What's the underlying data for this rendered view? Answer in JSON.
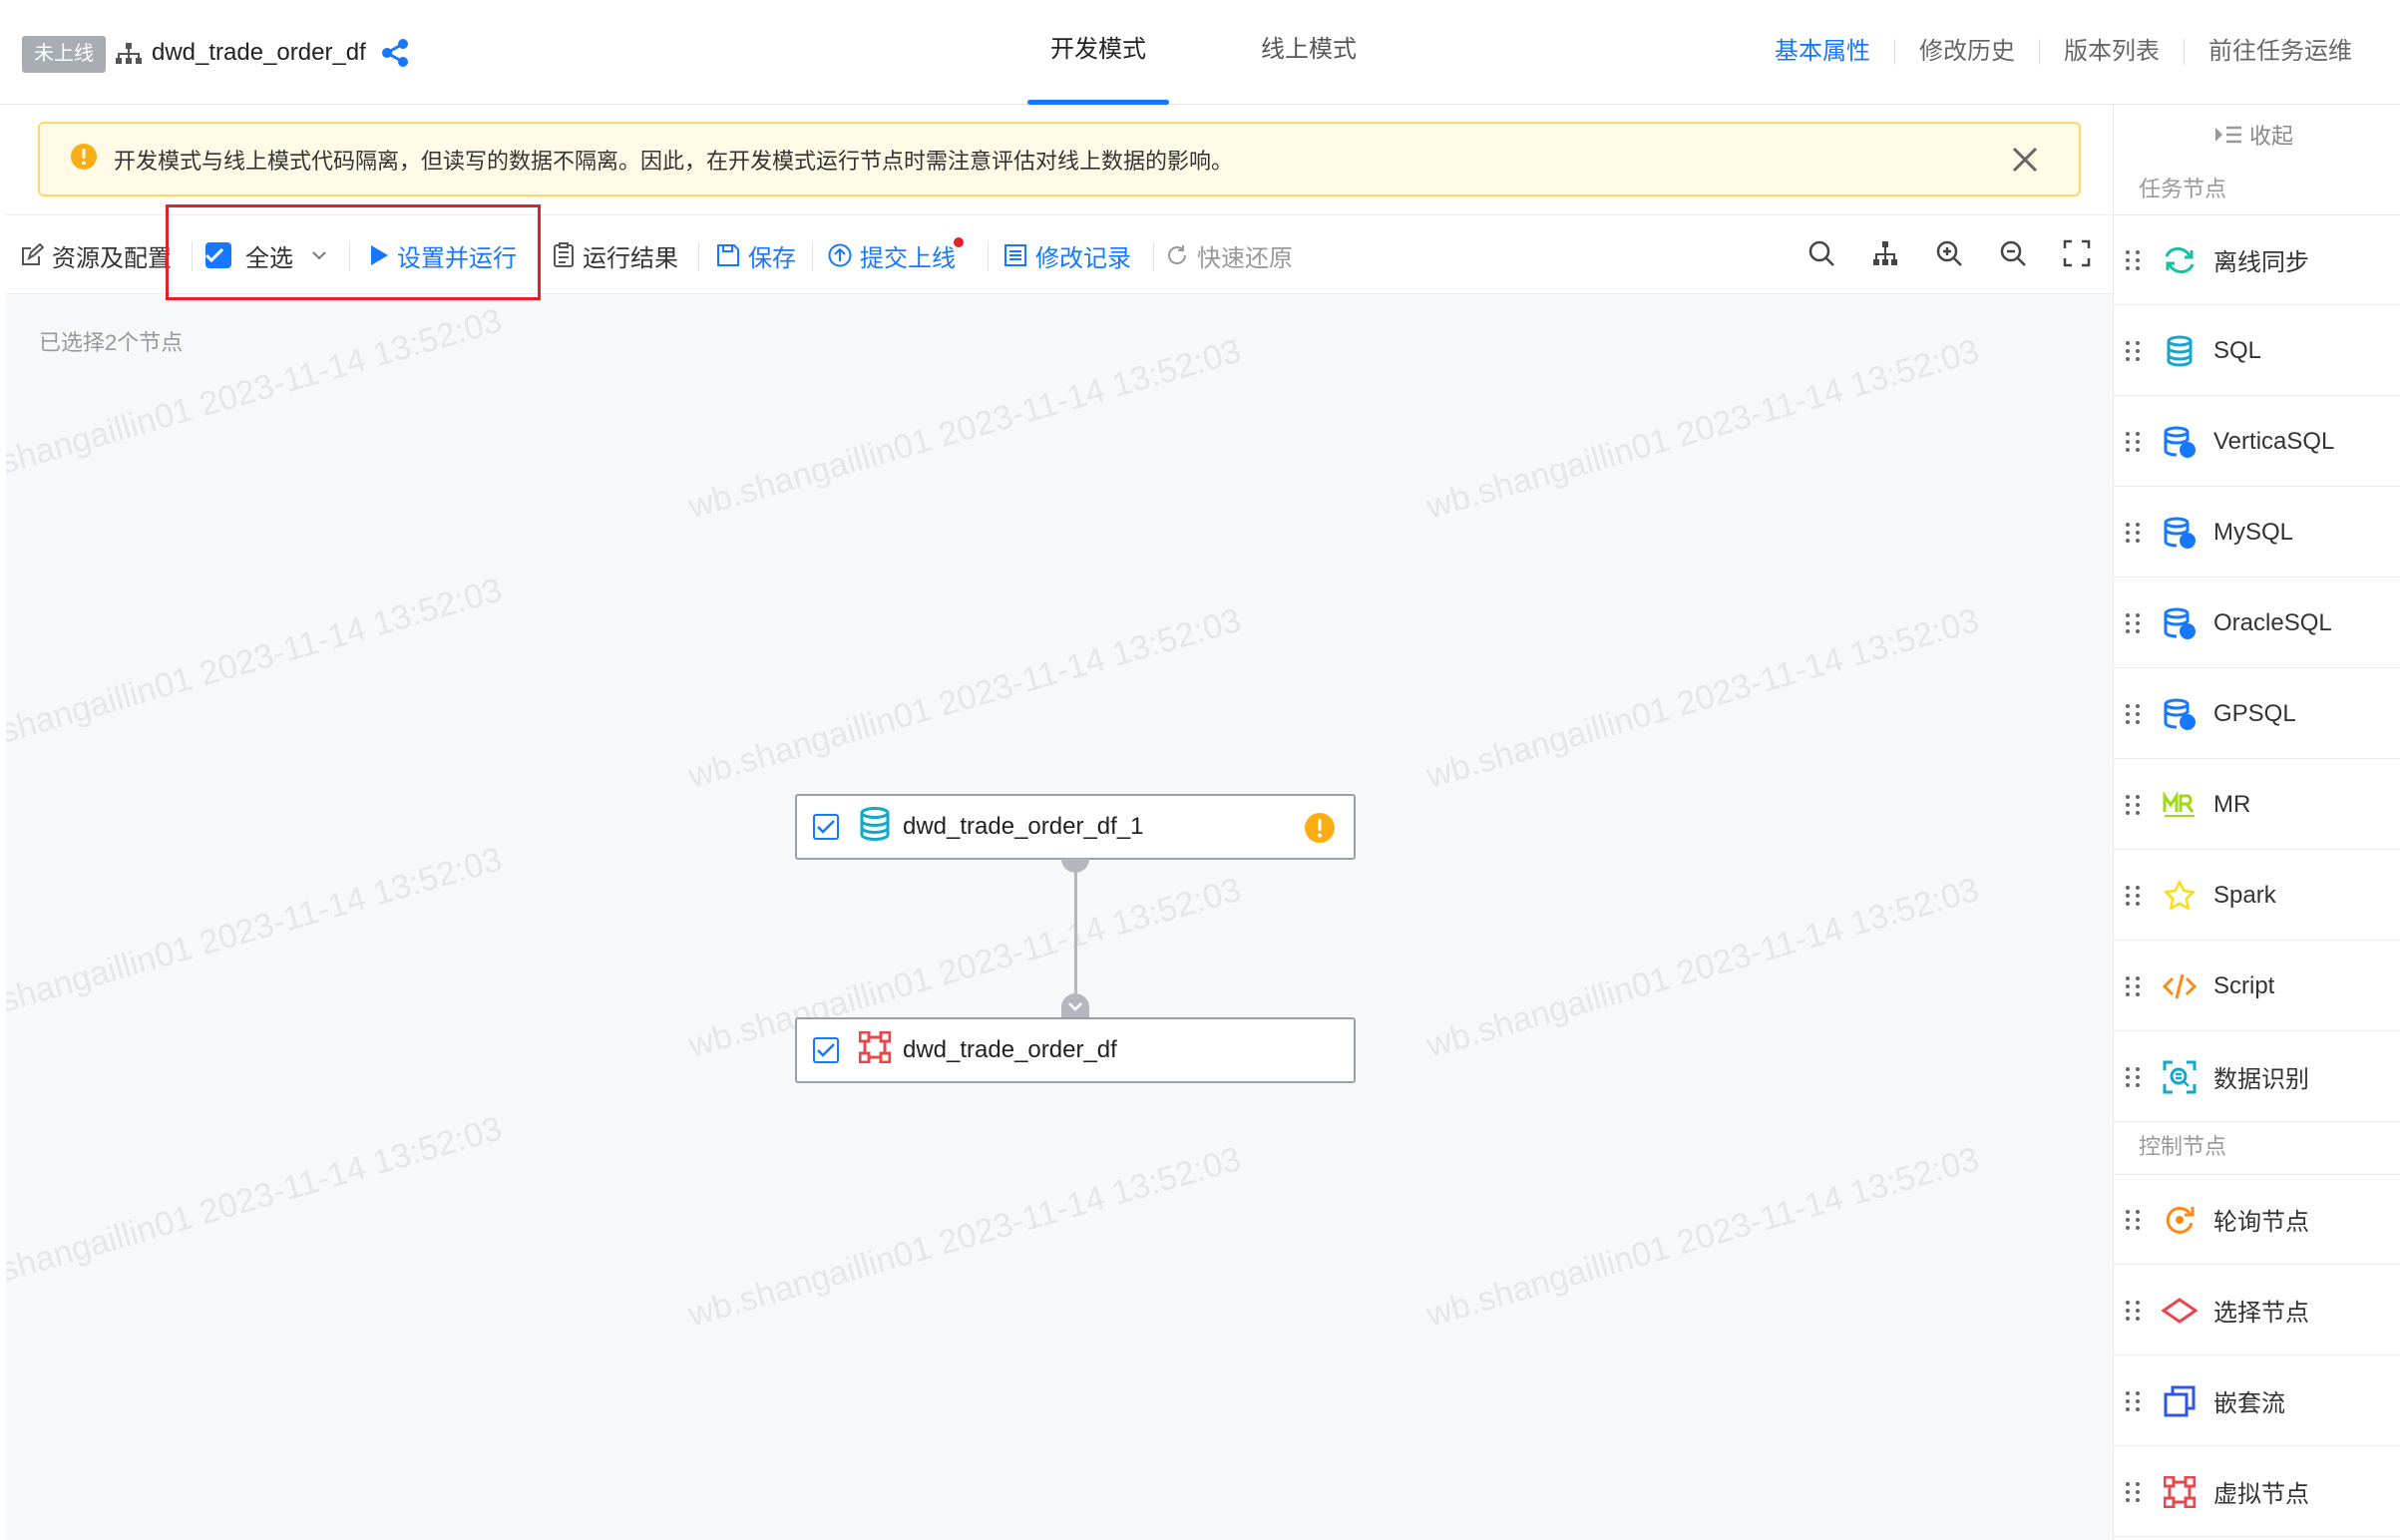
{
  "header": {
    "status_tag": "未上线",
    "task_name": "dwd_trade_order_df",
    "mode_tabs": [
      {
        "label": "开发模式",
        "active": true
      },
      {
        "label": "线上模式",
        "active": false
      }
    ],
    "links": [
      "基本属性",
      "修改历史",
      "版本列表",
      "前往任务运维"
    ]
  },
  "alert": {
    "text": "开发模式与线上模式代码隔离，但读写的数据不隔离。因此，在开发模式运行节点时需注意评估对线上数据的影响。"
  },
  "toolbar": {
    "resources": "资源及配置",
    "select_all": "全选",
    "set_and_run": "设置并运行",
    "run_result": "运行结果",
    "save": "保存",
    "submit_online": "提交上线",
    "change_log": "修改记录",
    "quick_restore": "快速还原"
  },
  "canvas": {
    "selected_count": "已选择2个节点",
    "watermark": "wb.shangaillin01 2023-11-14 13:52:03",
    "watermark_left": "shangaillin01 2023-11-14 13:52:03",
    "nodes": [
      {
        "label": "dwd_trade_order_df_1",
        "icon": "sql-database-icon",
        "checked": true,
        "warning": true
      },
      {
        "label": "dwd_trade_order_df",
        "icon": "virtual-node-icon",
        "checked": true,
        "warning": false
      }
    ]
  },
  "panel": {
    "collapse": "收起",
    "task_nodes_title": "任务节点",
    "task_nodes": [
      "离线同步",
      "SQL",
      "VerticaSQL",
      "MySQL",
      "OracleSQL",
      "GPSQL",
      "MR",
      "Spark",
      "Script",
      "数据识别"
    ],
    "control_nodes_title": "控制节点",
    "control_nodes": [
      "轮询节点",
      "选择节点",
      "嵌套流",
      "虚拟节点"
    ]
  },
  "colors": {
    "primary": "#1677ff",
    "warning": "#faad14",
    "highlight": "#e5202a"
  }
}
